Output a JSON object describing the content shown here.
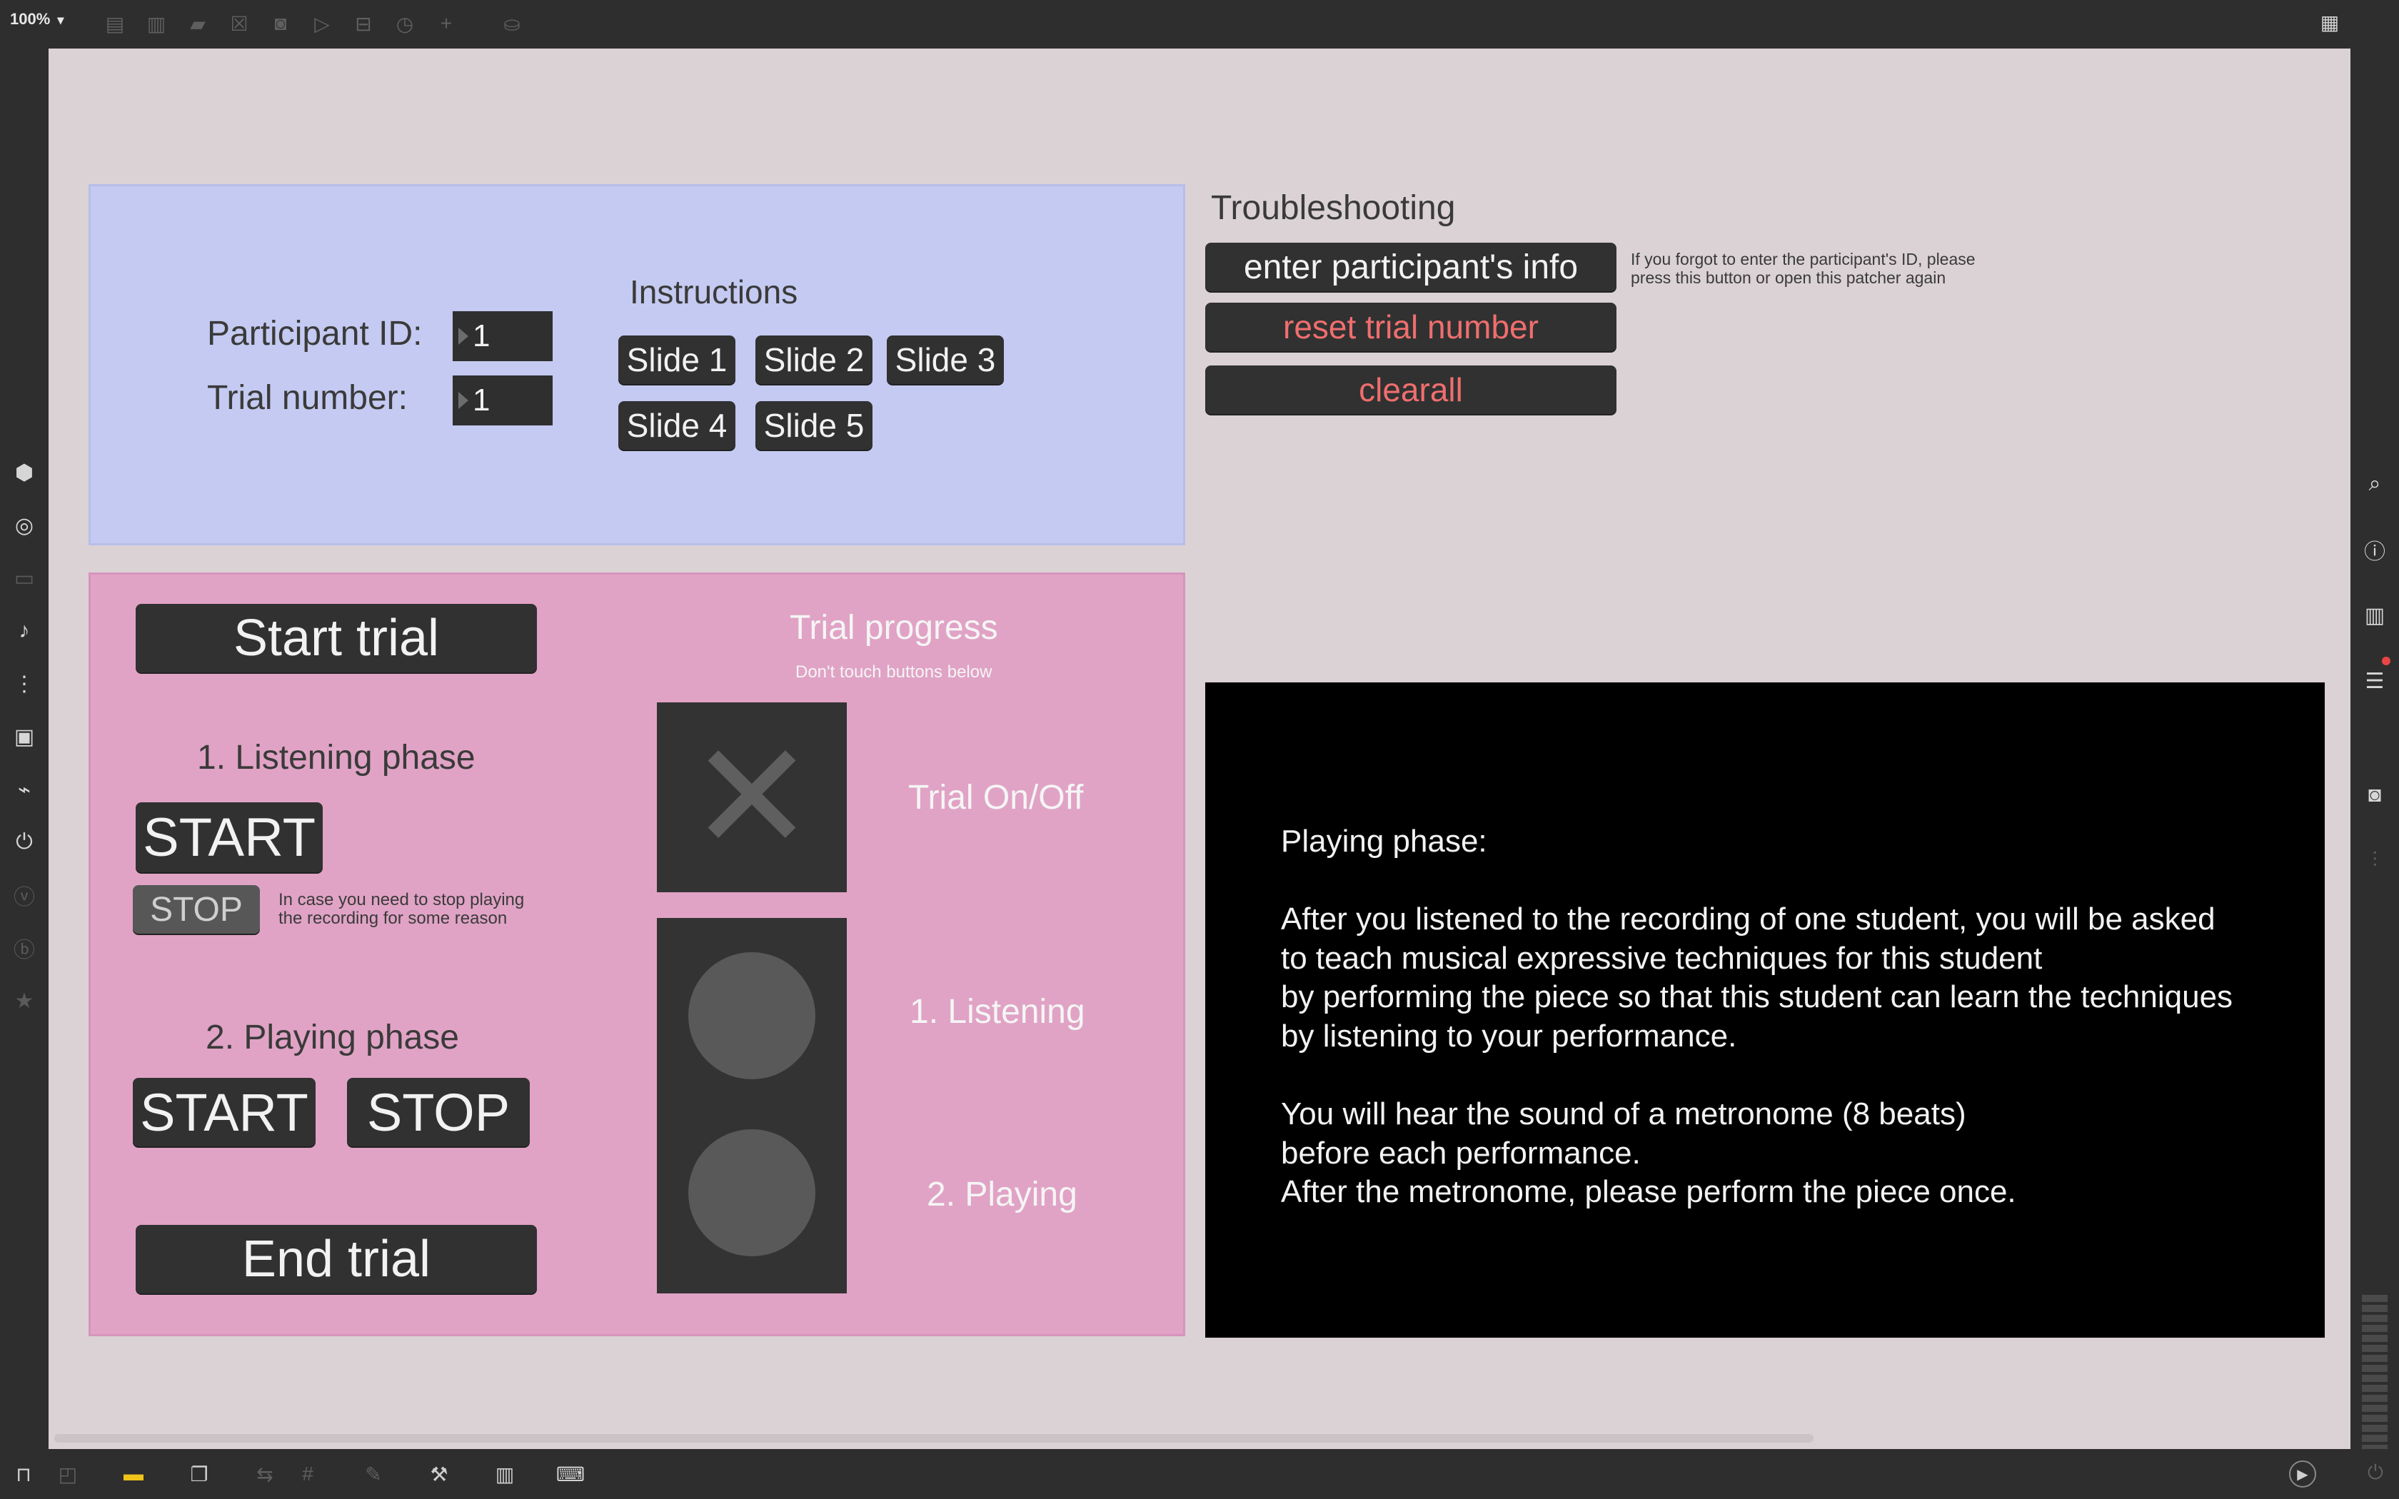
{
  "toolbar": {
    "zoom_label": "100%",
    "zoom_caret": "▾",
    "icons": [
      "new-object-icon",
      "message-icon",
      "comment-icon",
      "toggle-icon",
      "button-icon",
      "playbar-icon",
      "slider-icon",
      "dial-icon",
      "add-icon",
      "paint-bucket-icon"
    ],
    "grid_icon": "▦"
  },
  "left_sidebar": {
    "icons": [
      {
        "name": "package-icon",
        "glyph": "⬢"
      },
      {
        "name": "target-icon",
        "glyph": "◎"
      },
      {
        "name": "film-icon",
        "glyph": "▭"
      },
      {
        "name": "music-note-icon",
        "glyph": "♪"
      },
      {
        "name": "sequencer-icon",
        "glyph": "⋮"
      },
      {
        "name": "image-icon",
        "glyph": "▣"
      },
      {
        "name": "paperclip-icon",
        "glyph": "⌁"
      },
      {
        "name": "plug-icon",
        "glyph": "⏻"
      },
      {
        "name": "vimeo-icon",
        "glyph": "ⓥ"
      },
      {
        "name": "b-icon",
        "glyph": "ⓑ"
      },
      {
        "name": "star-icon",
        "glyph": "★"
      }
    ]
  },
  "right_sidebar": {
    "icons": [
      {
        "name": "search-icon",
        "glyph": "⌕"
      },
      {
        "name": "info-icon",
        "glyph": "ⓘ"
      },
      {
        "name": "book-icon",
        "glyph": "▥"
      },
      {
        "name": "list-icon",
        "glyph": "☰"
      },
      {
        "name": "camera-icon",
        "glyph": "◙"
      },
      {
        "name": "mixer-icon",
        "glyph": "⫶"
      }
    ]
  },
  "bottom_bar": {
    "icons": [
      {
        "name": "lock-icon",
        "glyph": "🔒"
      },
      {
        "name": "select-icon",
        "glyph": "◰"
      },
      {
        "name": "comment-icon",
        "glyph": "▬"
      },
      {
        "name": "windows-icon",
        "glyph": "❐"
      },
      {
        "name": "align-icon",
        "glyph": "⇆"
      },
      {
        "name": "grid-icon",
        "glyph": "#"
      },
      {
        "name": "pin-icon",
        "glyph": "✎"
      },
      {
        "name": "wrench-icon",
        "glyph": "🔧"
      },
      {
        "name": "piano-icon",
        "glyph": "▥"
      },
      {
        "name": "keyboard-icon",
        "glyph": "⌨"
      }
    ],
    "play_icon": "▶",
    "power_icon": "⏻"
  },
  "setup": {
    "participant_label": "Participant ID:",
    "participant_value": "1",
    "trial_label": "Trial number:",
    "trial_value": "1",
    "instructions_title": "Instructions",
    "slides": [
      "Slide 1",
      "Slide 2",
      "Slide 3",
      "Slide 4",
      "Slide 5"
    ]
  },
  "troubleshooting": {
    "title": "Troubleshooting",
    "enter_info_label": "enter participant's info",
    "reset_label": "reset trial number",
    "clearall_label": "clearall",
    "note_line1": "If you forgot to enter the participant's ID, please",
    "note_line2": "press this button or open this patcher again"
  },
  "trial": {
    "start_trial_label": "Start trial",
    "listening_title": "1. Listening phase",
    "listen_start_label": "START",
    "listen_stop_label": "STOP",
    "stop_note_line1": "In case you need to stop playing",
    "stop_note_line2": "the recording for some reason",
    "playing_title": "2. Playing phase",
    "play_start_label": "START",
    "play_stop_label": "STOP",
    "end_trial_label": "End trial",
    "progress_title": "Trial progress",
    "progress_note": "Don't touch buttons below",
    "toggle_label": "Trial On/Off",
    "listening_label": "1. Listening",
    "playing_label": "2. Playing",
    "toggle_glyph": "✕"
  },
  "message": {
    "text": "Playing phase:\n\nAfter you listened to the recording of one student, you will be asked\nto teach musical expressive techniques for this student\nby performing the piece so that this student can learn the techniques\nby listening to your performance.\n\nYou will hear the sound of a metronome (8 beats)\nbefore each performance.\nAfter the metronome, please perform the piece once."
  }
}
